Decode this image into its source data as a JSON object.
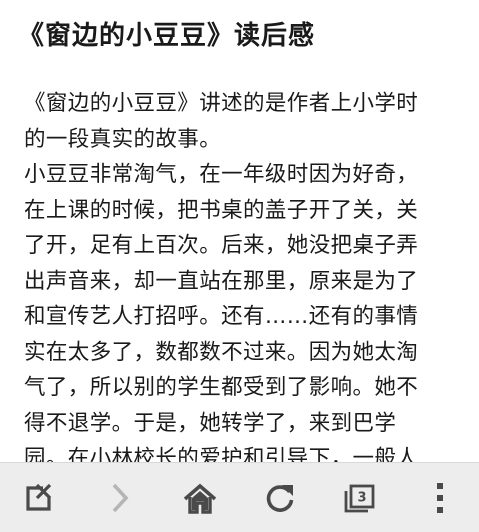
{
  "article": {
    "title": "《窗边的小豆豆》读后感",
    "paragraph1": [
      "《窗边的小豆豆》讲述的是作者上小学时",
      "的一段真实的故事。"
    ],
    "paragraph2": [
      "小豆豆非常淘气，在一年级时因为好奇，",
      "在上课的时候，把书桌的盖子开了关，关",
      "了开，足有上百次。后来，她没把桌子弄",
      "出声音来，却一直站在那里，原来是为了",
      "和宣传艺人打招呼。还有……还有的事情",
      "实在太多了，数都数不过来。因为她太淘",
      "气了，所以别的学生都受到了影响。她不",
      "得不退学。于是，她转学了，来到巴学",
      "园。在小林校长的爱护和引导下，一般人"
    ]
  },
  "toolbar": {
    "tab_count": "3",
    "icons": [
      "close-tab-icon",
      "forward-icon",
      "home-icon",
      "reload-icon",
      "tabs-icon",
      "menu-icon"
    ],
    "icon_color": "#4a4a4a",
    "disabled_color": "#b5b5b5",
    "background": "#ededed"
  }
}
